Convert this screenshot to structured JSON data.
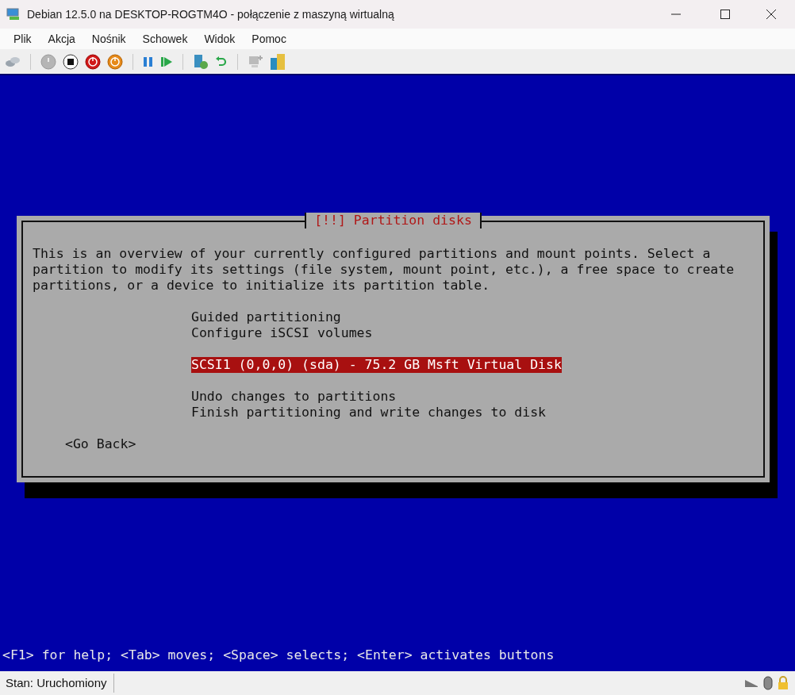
{
  "window": {
    "title": "Debian 12.5.0 na DESKTOP-ROGTM4O - połączenie z maszyną wirtualną"
  },
  "menu": [
    "Plik",
    "Akcja",
    "Nośnik",
    "Schowek",
    "Widok",
    "Pomoc"
  ],
  "dialog": {
    "title": "[!!] Partition disks",
    "description": "This is an overview of your currently configured partitions and mount points. Select a partition to modify its settings (file system, mount point, etc.), a free space to create partitions, or a device to initialize its partition table.",
    "menu_groups": [
      [
        {
          "label": "Guided partitioning",
          "selected": false
        },
        {
          "label": "Configure iSCSI volumes",
          "selected": false
        }
      ],
      [
        {
          "label": "SCSI1 (0,0,0) (sda) - 75.2 GB Msft Virtual Disk",
          "selected": true
        }
      ],
      [
        {
          "label": "Undo changes to partitions",
          "selected": false
        },
        {
          "label": "Finish partitioning and write changes to disk",
          "selected": false
        }
      ]
    ],
    "back_button": "<Go Back>"
  },
  "help_line": "<F1> for help; <Tab> moves; <Space> selects; <Enter> activates buttons",
  "status_bar": {
    "status": "Stan: Uruchomiony"
  }
}
